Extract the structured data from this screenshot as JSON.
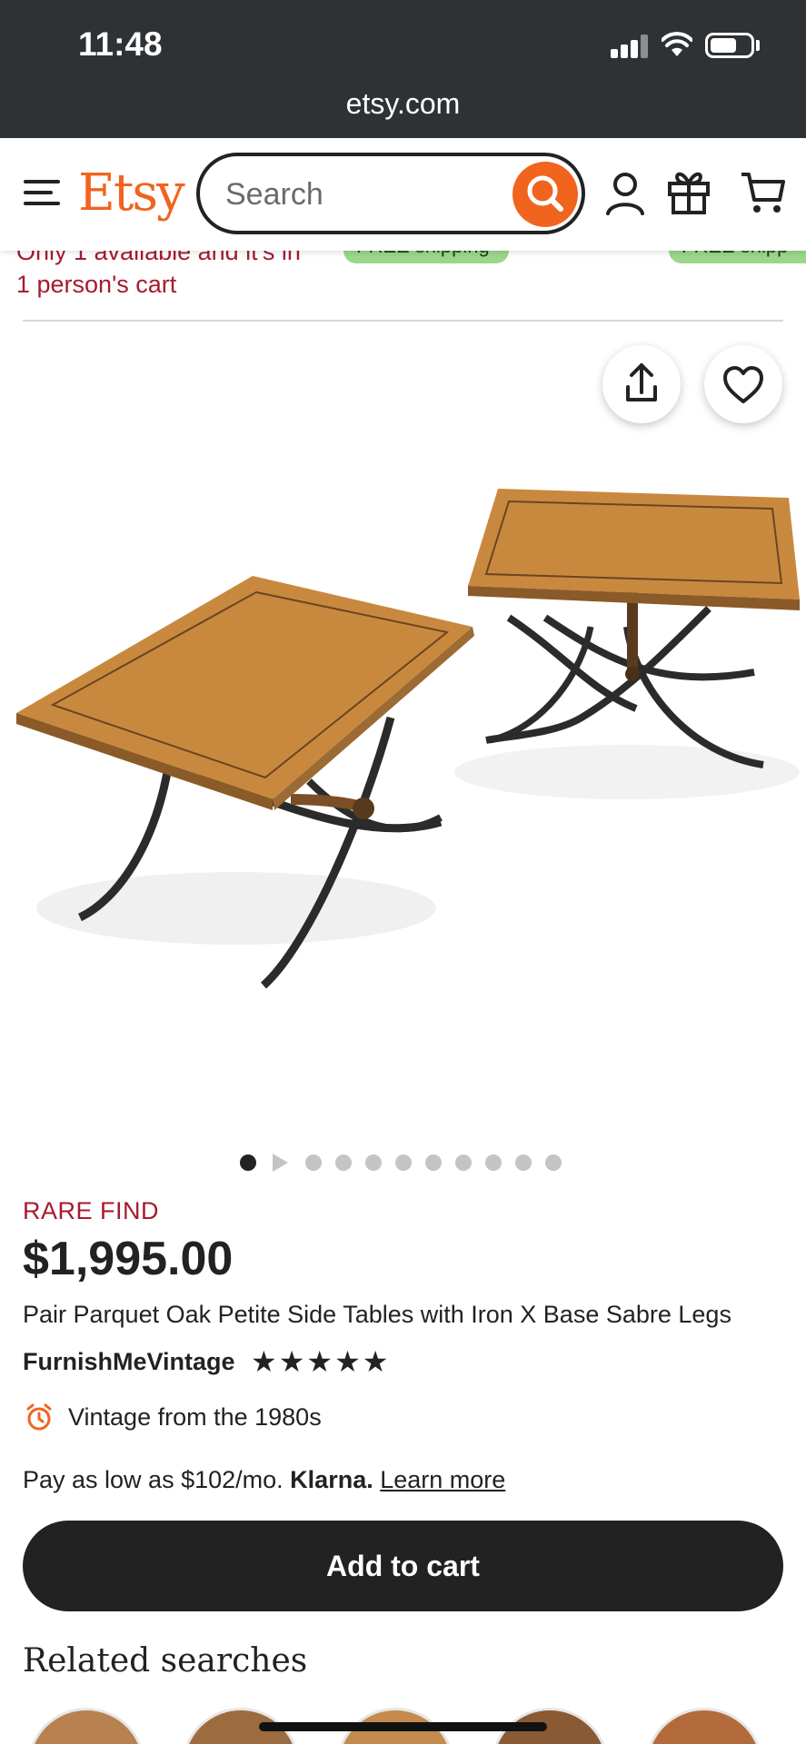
{
  "status_bar": {
    "time": "11:48",
    "url": "etsy.com"
  },
  "header": {
    "logo": "Etsy",
    "search_placeholder": "Search",
    "icons": [
      "menu-icon",
      "search-icon",
      "user-icon",
      "gift-icon",
      "cart-icon"
    ],
    "accent_color": "#F1641E"
  },
  "notice": {
    "line1": "Only 1 available and it's in",
    "line2": "1 person's cart",
    "chips": [
      "FREE shipping",
      "FREE shipp"
    ]
  },
  "gallery": {
    "active_index": 0,
    "dot_count": 11,
    "actions": [
      "share-icon",
      "heart-icon"
    ]
  },
  "product": {
    "badge": "RARE FIND",
    "price": "$1,995.00",
    "title": "Pair Parquet Oak Petite Side Tables with Iron X Base Sabre Legs",
    "shop": "FurnishMeVintage",
    "rating_stars": "★★★★★",
    "rating": 5,
    "vintage": "Vintage from the 1980s"
  },
  "financing": {
    "prefix": "Pay as low as $102/mo.",
    "brand": "Klarna.",
    "link": "Learn more"
  },
  "cta": {
    "add_to_cart": "Add to cart"
  },
  "related": {
    "heading": "Related searches"
  }
}
